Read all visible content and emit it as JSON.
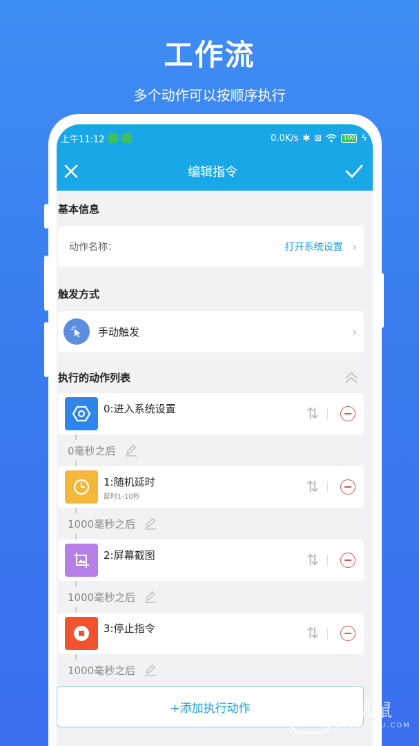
{
  "promo": {
    "title": "工作流",
    "subtitle": "多个动作可以按顺序执行"
  },
  "status_bar": {
    "time": "上午11:12",
    "net_speed": "0.0K/s",
    "battery": "100"
  },
  "app_bar": {
    "title": "编辑指令",
    "close_icon": "close-icon",
    "confirm_icon": "check-icon"
  },
  "basic_info": {
    "section_title": "基本信息",
    "name_label": "动作名称：",
    "name_value": "打开系统设置"
  },
  "trigger": {
    "section_title": "触发方式",
    "label": "手动触发"
  },
  "actions": {
    "section_title": "执行的动作列表",
    "items": [
      {
        "title": "0:进入系统设置",
        "subtitle": "",
        "color": "#2f86e8",
        "icon": "settings-hex-icon"
      },
      {
        "title": "1:随机延时",
        "subtitle": "延时1-10秒",
        "color": "#f3b83a",
        "icon": "clock-icon"
      },
      {
        "title": "2:屏幕截图",
        "subtitle": "",
        "color": "#b77ee8",
        "icon": "screenshot-icon"
      },
      {
        "title": "3:停止指令",
        "subtitle": "",
        "color": "#f0532f",
        "icon": "stop-icon"
      }
    ],
    "delays": [
      "0毫秒之后",
      "1000毫秒之后",
      "1000毫秒之后",
      "1000毫秒之后"
    ],
    "add_label": "+添加执行动作"
  },
  "watermark": {
    "cn": "手机鼠",
    "en": "SHOUJISHU.COM"
  }
}
